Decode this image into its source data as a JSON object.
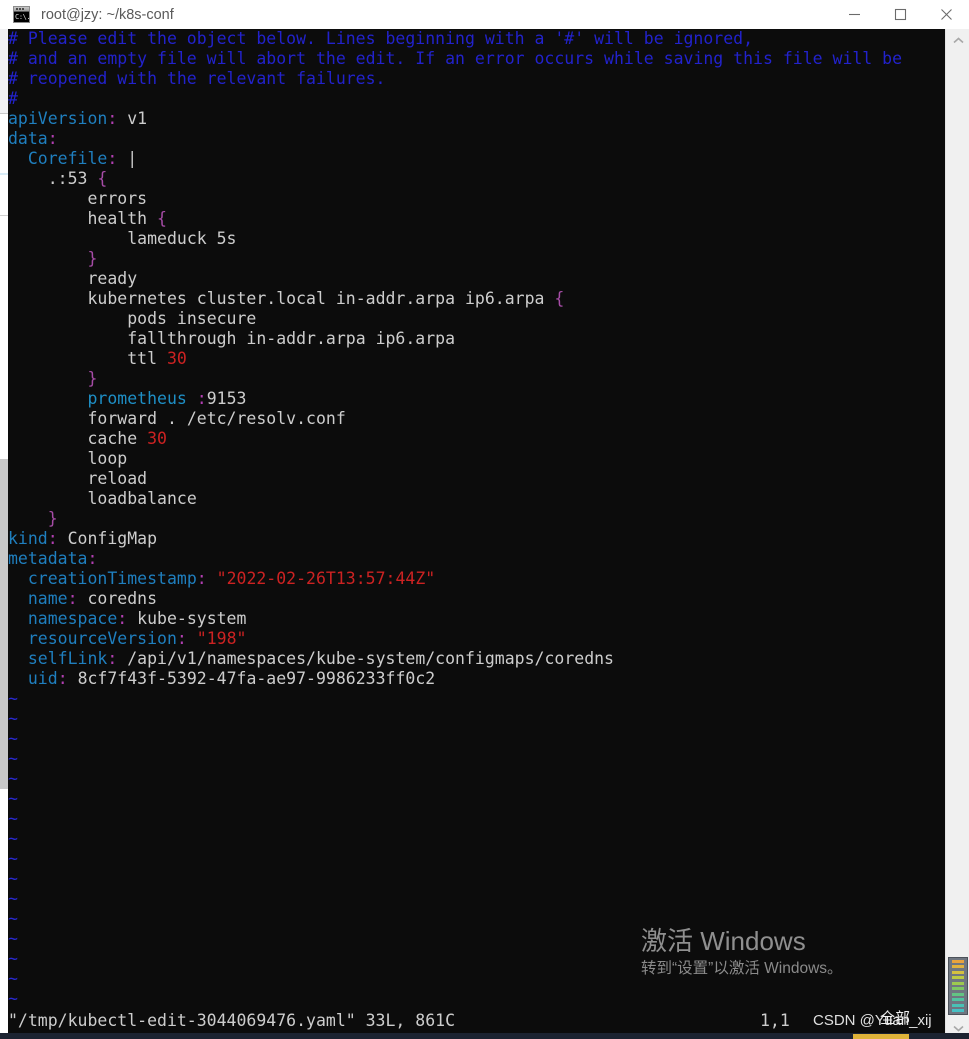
{
  "window": {
    "title": "root@jzy: ~/k8s-conf",
    "icon_name": "terminal-icon",
    "icon_glyph": "C:\\.",
    "controls": [
      {
        "name": "minimize-button",
        "glyph": "minimize"
      },
      {
        "name": "maximize-button",
        "glyph": "maximize"
      },
      {
        "name": "close-button",
        "glyph": "close"
      }
    ]
  },
  "editor": {
    "lines": [
      {
        "t": "comment",
        "text": "# Please edit the object below. Lines beginning with a '#' will be ignored,"
      },
      {
        "t": "comment",
        "text": "# and an empty file will abort the edit. If an error occurs while saving this file will be"
      },
      {
        "t": "comment",
        "text": "# reopened with the relevant failures."
      },
      {
        "t": "comment",
        "text": "#"
      },
      {
        "t": "yaml",
        "key": "apiVersion",
        "indent": 0,
        "value": "v1"
      },
      {
        "t": "yaml",
        "key": "data",
        "indent": 0,
        "value": ""
      },
      {
        "t": "yaml",
        "key": "Corefile",
        "indent": 2,
        "value": "|"
      },
      {
        "t": "block",
        "indent": 4,
        "text": ".:53 ",
        "brace": "{"
      },
      {
        "t": "block",
        "indent": 8,
        "text": "errors",
        "brace": ""
      },
      {
        "t": "block",
        "indent": 8,
        "text": "health ",
        "brace": "{"
      },
      {
        "t": "block",
        "indent": 12,
        "text": "lameduck 5s",
        "brace": ""
      },
      {
        "t": "block",
        "indent": 8,
        "text": "",
        "brace": "}"
      },
      {
        "t": "block",
        "indent": 8,
        "text": "ready",
        "brace": ""
      },
      {
        "t": "block",
        "indent": 8,
        "text": "kubernetes cluster.local in-addr.arpa ip6.arpa ",
        "brace": "{"
      },
      {
        "t": "block",
        "indent": 12,
        "text": "pods insecure",
        "brace": ""
      },
      {
        "t": "block",
        "indent": 12,
        "text": "fallthrough in-addr.arpa ip6.arpa",
        "brace": ""
      },
      {
        "t": "ttl",
        "indent": 12,
        "text": "ttl ",
        "num": "30"
      },
      {
        "t": "block",
        "indent": 8,
        "text": "",
        "brace": "}"
      },
      {
        "t": "prom",
        "indent": 8,
        "text": "prometheus ",
        "colon": ":",
        "num": "9153"
      },
      {
        "t": "block",
        "indent": 8,
        "text": "forward . /etc/resolv.conf",
        "brace": ""
      },
      {
        "t": "ttl",
        "indent": 8,
        "text": "cache ",
        "num": "30"
      },
      {
        "t": "block",
        "indent": 8,
        "text": "loop",
        "brace": ""
      },
      {
        "t": "block",
        "indent": 8,
        "text": "reload",
        "brace": ""
      },
      {
        "t": "block",
        "indent": 8,
        "text": "loadbalance",
        "brace": ""
      },
      {
        "t": "block",
        "indent": 4,
        "text": "",
        "brace": "}"
      },
      {
        "t": "yaml",
        "key": "kind",
        "indent": 0,
        "value": "ConfigMap"
      },
      {
        "t": "yaml",
        "key": "metadata",
        "indent": 0,
        "value": ""
      },
      {
        "t": "yamlstr",
        "key": "creationTimestamp",
        "indent": 2,
        "value": "\"2022-02-26T13:57:44Z\""
      },
      {
        "t": "yaml",
        "key": "name",
        "indent": 2,
        "value": "coredns"
      },
      {
        "t": "yaml",
        "key": "namespace",
        "indent": 2,
        "value": "kube-system"
      },
      {
        "t": "yamlstr",
        "key": "resourceVersion",
        "indent": 2,
        "value": "\"198\""
      },
      {
        "t": "yaml",
        "key": "selfLink",
        "indent": 2,
        "value": "/api/v1/namespaces/kube-system/configmaps/coredns"
      },
      {
        "t": "yaml",
        "key": "uid",
        "indent": 2,
        "value": "8cf7f43f-5392-47fa-ae97-9986233ff0c2"
      }
    ],
    "empty_marker": "~",
    "empty_marker_count": 16
  },
  "status": {
    "file_info": "\"/tmp/kubectl-edit-3044069476.yaml\" 33L, 861C",
    "cursor_position": "1,1",
    "watermark_text": "CSDN @Yuan_xij",
    "watermark_cn": "全部"
  },
  "activation": {
    "line1": "激活 Windows",
    "line2": "转到“设置”以激活 Windows。"
  },
  "scrollbar": {
    "up_name": "scroll-up-arrow",
    "down_name": "scroll-down-arrow",
    "gauge_name": "battery-gauge-icon"
  },
  "colors": {
    "terminal_bg": "#0c0c0c",
    "comment": "#2222cc",
    "key": "#1f7fbf",
    "colon": "#b33fb3",
    "string": "#cc2222",
    "number": "#cc2222",
    "plain": "#cdcdcd",
    "tilde": "#2a2ad1",
    "titlebar_bg": "#ffffff",
    "scrollbar_bg": "#f0f0f0"
  }
}
